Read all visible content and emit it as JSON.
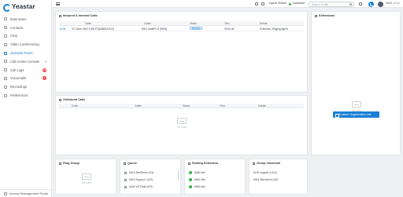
{
  "brand": {
    "name": "Yeastar",
    "color": "#1a7fd4"
  },
  "sidebar": {
    "items": [
      {
        "label": "Extensions",
        "icon": "user-icon"
      },
      {
        "label": "Contacts",
        "icon": "contacts-icon"
      },
      {
        "label": "Chat",
        "icon": "chat-icon"
      },
      {
        "label": "Video Conferencing",
        "icon": "video-icon"
      },
      {
        "label": "Operator Panel",
        "icon": "panel-icon",
        "active": true
      },
      {
        "label": "Call Center Console",
        "icon": "headset-icon",
        "chevron": true
      },
      {
        "label": "Call Logs",
        "icon": "call-log-icon",
        "badge": "99"
      },
      {
        "label": "Voicemails",
        "icon": "voicemail-icon",
        "badge": "1"
      },
      {
        "label": "Recordings",
        "icon": "recording-icon"
      },
      {
        "label": "Preferences",
        "icon": "gear-icon"
      }
    ],
    "footer": "Access Management Portal"
  },
  "topbar": {
    "agent_status_label": "Agent Status",
    "presence_label": "Available",
    "search_placeholder": "Search or dial",
    "user_label": "1001, Li Li"
  },
  "internal_calls": {
    "title": "Inbound & Internal Calls",
    "columns": [
      "Caller",
      "Callee",
      "Status",
      "Time",
      "Details"
    ],
    "rows": [
      {
        "type": "ACW",
        "caller": "VC Dave-VNG 4785-PC[8480847510]",
        "callee": "8001 Staff/PCG [9503]",
        "status": "Ringing",
        "time": "00:00:48",
        "details": "Extension, Ringing Agent"
      }
    ]
  },
  "outbound_calls": {
    "title": "Outbound Calls",
    "columns": [
      "Caller",
      "Callee",
      "Status",
      "Time",
      "Details"
    ],
    "empty_text": "No Data"
  },
  "extensions_panel": {
    "title": "Extensions",
    "empty_text": "No Data",
    "button_label": "Custom Organization List"
  },
  "ring_group": {
    "title": "Ring Group",
    "empty_text": "No Data"
  },
  "queue": {
    "title": "Queue",
    "items": [
      "6401 Site/Demo (2/4)",
      "6401 Support 1 (0/0)",
      "6402 VIP Desk (0/0)"
    ]
  },
  "parking": {
    "title": "Parking Extension",
    "items": [
      "6060 Idle",
      "6061 Idle",
      "6062 Idle"
    ]
  },
  "group_voicemail": {
    "title": "Group Voicemail",
    "items": [
      "6700 support-4 (0/1)",
      "6401 Site/Demo (0/0)"
    ]
  }
}
